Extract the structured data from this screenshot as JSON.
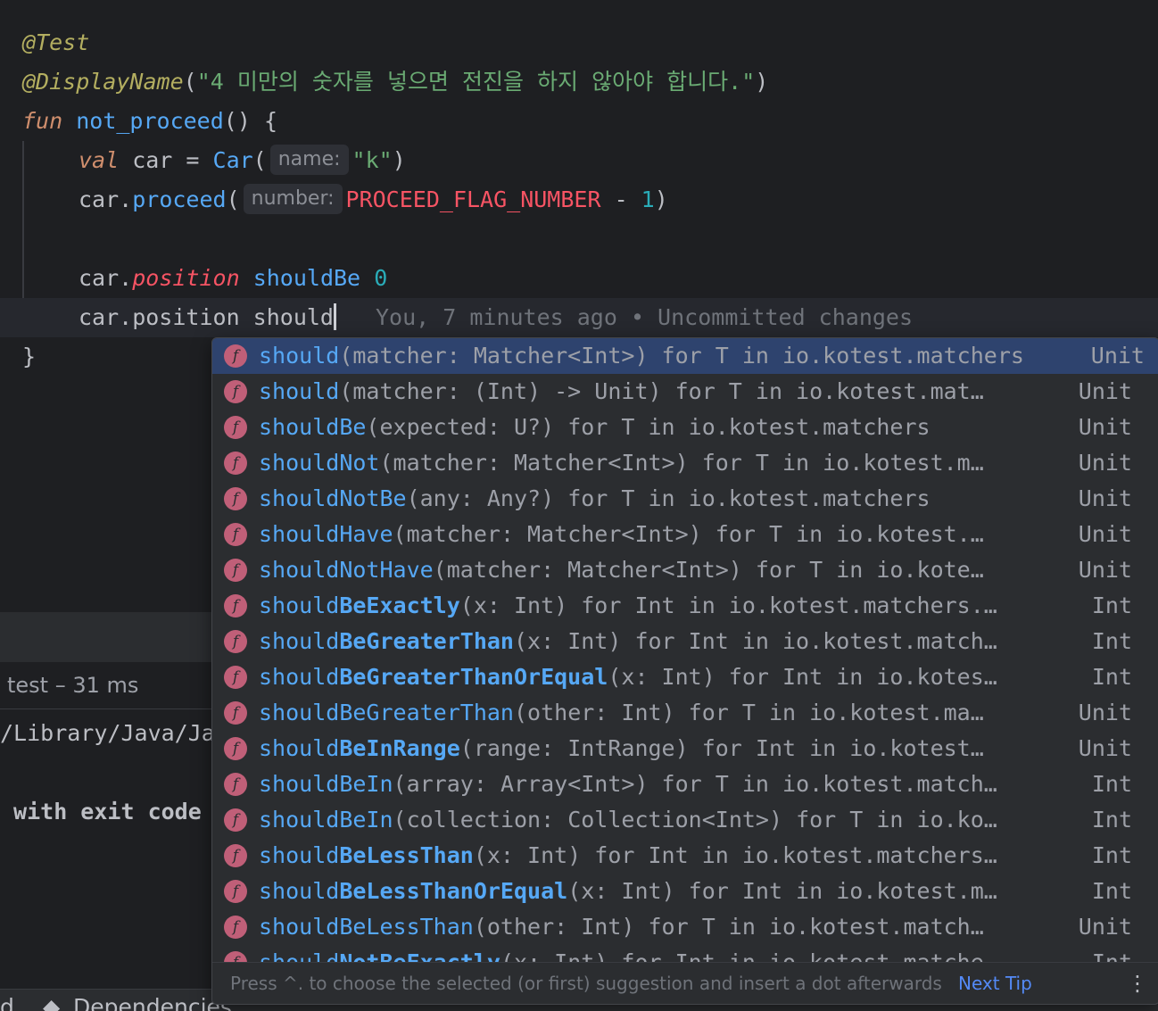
{
  "editor": {
    "lines": {
      "annotation_test": "@Test",
      "display_name_ann": "@DisplayName",
      "display_name_paren_open": "(",
      "display_name_string": "\"4 미만의 숫자를 넣으면 전진을 하지 않아야 합니다.\"",
      "display_name_paren_close": ")",
      "fun_kw": "fun",
      "fun_name": "not_proceed",
      "fun_rest": "() {",
      "val_kw": "val",
      "car_decl": " car = ",
      "car_ctor": "Car",
      "paren_open": "(",
      "hint_name": "name:",
      "car_arg": "\"k\"",
      "paren_close": ")",
      "car_obj": "car",
      "dot": ".",
      "proceed_fn": "proceed",
      "hint_number": "number:",
      "proceed_const": "PROCEED_FLAG_NUMBER",
      "minus": " - ",
      "one": "1",
      "position_prop": "position",
      "should_be": "shouldBe",
      "zero": "0",
      "position_typed": "car.position should",
      "blame": "You, 7 minutes ago • Uncommitted changes",
      "closing_brace": "}"
    }
  },
  "run_panel": {
    "title": "test – 31 ms",
    "console_line1": "/Library/Java/Ja",
    "console_line2": " with exit code"
  },
  "status_bar": {
    "left_fragment": "d",
    "dependencies": "Dependencies"
  },
  "completion": {
    "icon_letter": "f",
    "items": [
      {
        "match": "should",
        "rest": "",
        "bold": false,
        "sig": "(matcher: Matcher<Int>) for T in io.kotest.matchers",
        "type": "Unit"
      },
      {
        "match": "should",
        "rest": "",
        "bold": false,
        "sig": "(matcher: (Int) -> Unit) for T in io.kotest.mat…",
        "type": "Unit"
      },
      {
        "match": "should",
        "rest": "Be",
        "bold": false,
        "sig": "(expected: U?) for T in io.kotest.matchers",
        "type": "Unit"
      },
      {
        "match": "should",
        "rest": "Not",
        "bold": false,
        "sig": "(matcher: Matcher<Int>) for T in io.kotest.m…",
        "type": "Unit"
      },
      {
        "match": "should",
        "rest": "NotBe",
        "bold": false,
        "sig": "(any: Any?) for T in io.kotest.matchers",
        "type": "Unit"
      },
      {
        "match": "should",
        "rest": "Have",
        "bold": false,
        "sig": "(matcher: Matcher<Int>) for T in io.kotest.…",
        "type": "Unit"
      },
      {
        "match": "should",
        "rest": "NotHave",
        "bold": false,
        "sig": "(matcher: Matcher<Int>) for T in io.kote…",
        "type": "Unit"
      },
      {
        "match": "should",
        "rest": "BeExactly",
        "bold": true,
        "sig": "(x: Int) for Int in io.kotest.matchers.…",
        "type": "Int"
      },
      {
        "match": "should",
        "rest": "BeGreaterThan",
        "bold": true,
        "sig": "(x: Int) for Int in io.kotest.match…",
        "type": "Int"
      },
      {
        "match": "should",
        "rest": "BeGreaterThanOrEqual",
        "bold": true,
        "sig": "(x: Int) for Int in io.kotes…",
        "type": "Int"
      },
      {
        "match": "should",
        "rest": "BeGreaterThan",
        "bold": false,
        "sig": "(other: Int) for T in io.kotest.ma…",
        "type": "Unit"
      },
      {
        "match": "should",
        "rest": "BeInRange",
        "bold": true,
        "sig": "(range: IntRange) for Int in io.kotest…",
        "type": "Unit"
      },
      {
        "match": "should",
        "rest": "BeIn",
        "bold": false,
        "sig": "(array: Array<Int>) for T in io.kotest.match…",
        "type": "Int"
      },
      {
        "match": "should",
        "rest": "BeIn",
        "bold": false,
        "sig": "(collection: Collection<Int>) for T in io.ko…",
        "type": "Int"
      },
      {
        "match": "should",
        "rest": "BeLessThan",
        "bold": true,
        "sig": "(x: Int) for Int in io.kotest.matchers…",
        "type": "Int"
      },
      {
        "match": "should",
        "rest": "BeLessThanOrEqual",
        "bold": true,
        "sig": "(x: Int) for Int in io.kotest.m…",
        "type": "Int"
      },
      {
        "match": "should",
        "rest": "BeLessThan",
        "bold": false,
        "sig": "(other: Int) for T in io.kotest.match…",
        "type": "Unit"
      },
      {
        "match": "should",
        "rest": "NotBeExactly",
        "bold": true,
        "sig": "(x: Int) for Int in io.kotest.matche…",
        "type": "Int"
      }
    ],
    "footer_hint": "Press ^. to choose the selected (or first) suggestion and insert a dot afterwards",
    "next_tip": "Next Tip",
    "menu_glyph": "⋮"
  }
}
